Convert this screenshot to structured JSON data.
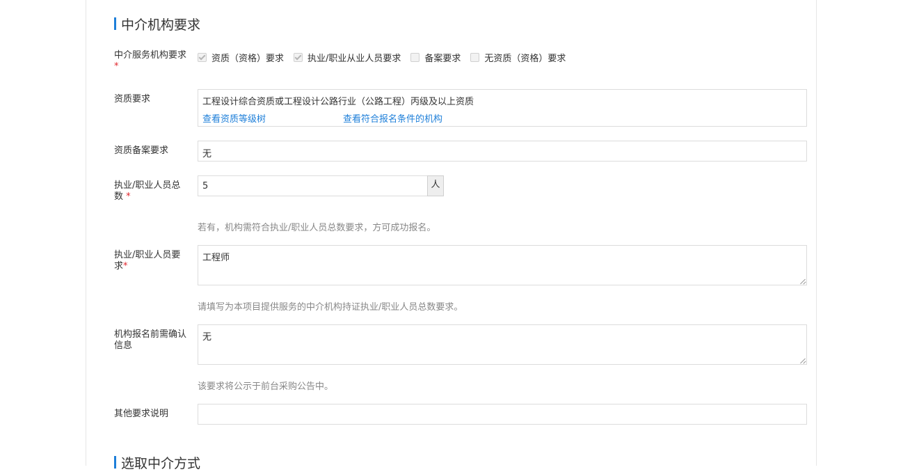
{
  "section": {
    "title": "中介机构要求",
    "next_title": "选取中介方式"
  },
  "service_requirement": {
    "label": "中介服务机构要求",
    "required": "*",
    "options": [
      {
        "label": "资质（资格）要求",
        "checked": true
      },
      {
        "label": "执业/职业从业人员要求",
        "checked": true
      },
      {
        "label": "备案要求",
        "checked": false
      },
      {
        "label": "无资质（资格）要求",
        "checked": false
      }
    ]
  },
  "qualification": {
    "label": "资质要求",
    "value": "工程设计综合资质或工程设计公路行业（公路工程）丙级及以上资质",
    "link_tree": "查看资质等级树",
    "link_orgs": "查看符合报名条件的机构"
  },
  "filing": {
    "label": "资质备案要求",
    "value": "无"
  },
  "staff_total": {
    "label": "执业/职业人员总数",
    "required": "*",
    "value": "5",
    "unit": "人",
    "hint": "若有，机构需符合执业/职业人员总数要求，方可成功报名。"
  },
  "staff_requirement": {
    "label": "执业/职业人员要求",
    "required": "*",
    "value": "工程师",
    "hint": "请填写为本项目提供服务的中介机构持证执业/职业人员总数要求。"
  },
  "confirm_info": {
    "label": "机构报名前需确认信息",
    "value": "无",
    "hint": "该要求将公示于前台采购公告中。"
  },
  "other": {
    "label": "其他要求说明",
    "value": ""
  }
}
